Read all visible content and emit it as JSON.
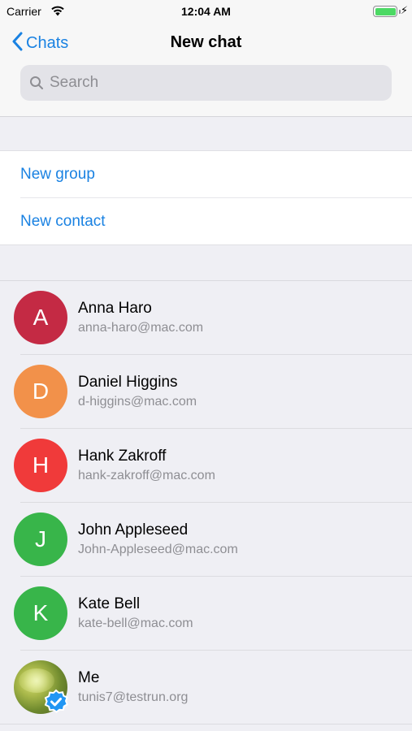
{
  "status_bar": {
    "carrier": "Carrier",
    "time": "12:04 AM",
    "battery_level": 1.0
  },
  "nav": {
    "back_label": "Chats",
    "title": "New chat"
  },
  "search": {
    "placeholder": "Search",
    "value": ""
  },
  "actions": [
    {
      "label": "New group"
    },
    {
      "label": "New contact"
    }
  ],
  "contacts": [
    {
      "initial": "A",
      "name": "Anna Haro",
      "email": "anna-haro@mac.com",
      "color": "#c42a44"
    },
    {
      "initial": "D",
      "name": "Daniel Higgins",
      "email": "d-higgins@mac.com",
      "color": "#f2914a"
    },
    {
      "initial": "H",
      "name": "Hank Zakroff",
      "email": "hank-zakroff@mac.com",
      "color": "#f03a3a"
    },
    {
      "initial": "J",
      "name": "John Appleseed",
      "email": "John-Appleseed@mac.com",
      "color": "#38b54a"
    },
    {
      "initial": "K",
      "name": "Kate Bell",
      "email": "kate-bell@mac.com",
      "color": "#38b54a"
    },
    {
      "initial": "",
      "name": "Me",
      "email": "tunis7@testrun.org",
      "color": "#8aa33a",
      "verified": true
    }
  ],
  "colors": {
    "accent": "#1a82e2",
    "battery": "#4cd964",
    "verified_badge": "#2196f3"
  },
  "icons": [
    "wifi-icon",
    "battery-icon",
    "charging-bolt-icon",
    "chevron-left-icon",
    "search-icon",
    "verified-icon"
  ]
}
